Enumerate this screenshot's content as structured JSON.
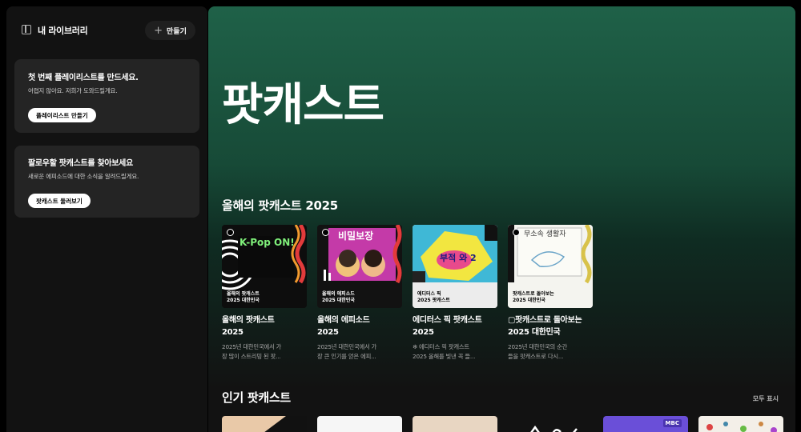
{
  "sidebar": {
    "library_title": "내 라이브러리",
    "create_label": "만들기",
    "playlist_card": {
      "title": "첫 번째 플레이리스트를 만드세요.",
      "subtitle": "어렵지 않아요. 저희가 도와드릴게요.",
      "button": "플레이리스트 만들기"
    },
    "podcast_card": {
      "title": "팔로우할 팟캐스트를 찾아보세요",
      "subtitle": "새로운 에피소드에 대한 소식을 알려드릴게요.",
      "button": "팟캐스트 둘러보기"
    }
  },
  "main": {
    "hero_title": "팟캐스트",
    "section1": {
      "title": "올해의 팟캐스트 2025",
      "tiles": [
        {
          "cover_caption_1": "올해의 팟캐스트",
          "cover_caption_2": "2025 대한민국",
          "cover_text": "K-Pop ON!",
          "title_1": "올해의 팟캐스트",
          "title_2": "2025",
          "desc_1": "2025년 대한민국에서 가",
          "desc_2": "장 많이 스트리밍 된 팟..."
        },
        {
          "cover_caption_1": "올해의 에피소드",
          "cover_caption_2": "2025 대한민국",
          "cover_text": "비밀보장",
          "title_1": "올해의 에피소드",
          "title_2": "2025",
          "desc_1": "2025년 대한민국에서 가",
          "desc_2": "장 큰 인기를 얻은 에피..."
        },
        {
          "cover_caption_1": "에디터스 픽",
          "cover_caption_2": "2025 팟캐스트",
          "cover_text": "부적 와 2",
          "title_1": "에디터스 픽 팟캐스트",
          "title_2": "2025",
          "desc_1": "❄ 에디터스 픽 팟캐스트",
          "desc_2": "2025 올해를 빛낸 꼭 들..."
        },
        {
          "cover_caption_1": "팟캐스트로 돌아보는",
          "cover_caption_2": "2025 대한민국",
          "cover_text": "무소속 생활자",
          "title_1": "▢팟캐스트로 돌아보는",
          "title_2": "2025 대한민국",
          "desc_1": "2025년 대한민국의 순간",
          "desc_2": "들을 팟캐스트로 다시..."
        }
      ]
    },
    "section2": {
      "title": "인기 팟캐스트",
      "show_all": "모두 표시",
      "badge": "MBC"
    }
  },
  "colors": {
    "accent_green": "#1ed760",
    "hero_top": "#1f6148",
    "surface": "#121212",
    "card": "#242424"
  }
}
